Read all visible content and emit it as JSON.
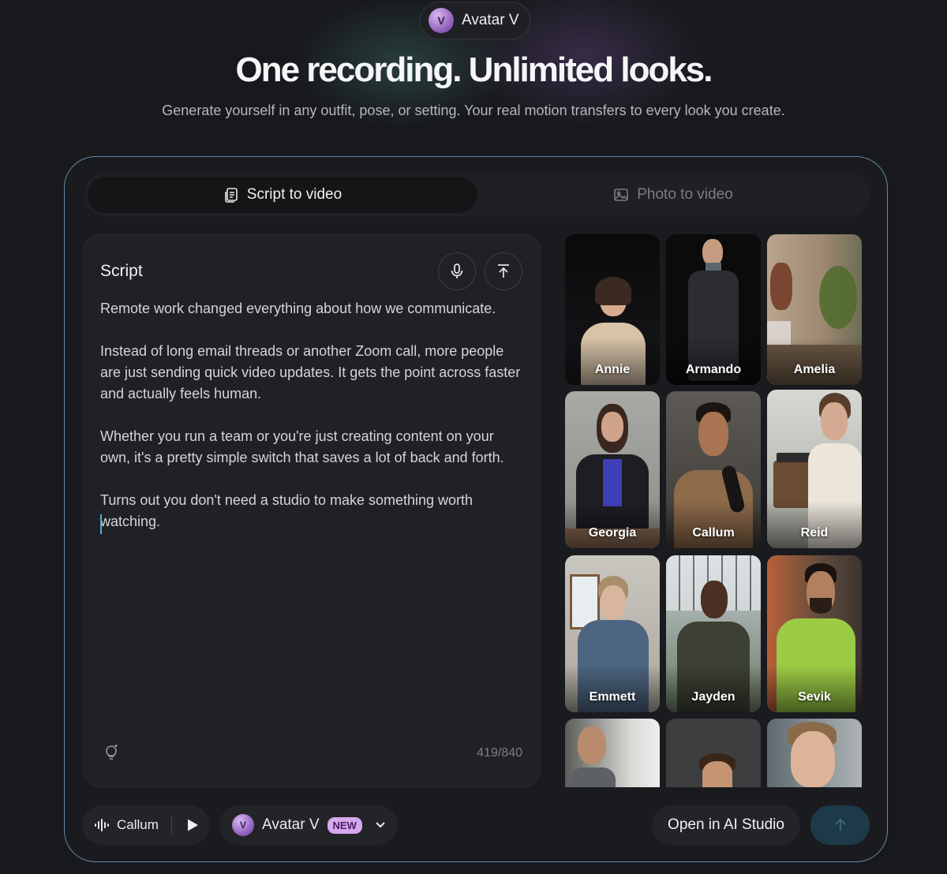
{
  "top_pill": {
    "badge": "V",
    "label": "Avatar V"
  },
  "headline": "One recording. Unlimited looks.",
  "subhead": "Generate yourself in any outfit, pose, or setting. Your real motion transfers to every look you create.",
  "tabs": [
    {
      "label": "Script to video",
      "icon": "script-icon",
      "active": true
    },
    {
      "label": "Photo to video",
      "icon": "image-icon",
      "active": false
    }
  ],
  "script": {
    "title": "Script",
    "paragraphs": [
      "Remote work changed everything about how we communicate.",
      "Instead of long email threads or another Zoom call, more people are just sending quick video updates. It gets the point across faster and actually feels human.",
      "Whether you run a team or you're just creating content on your own, it's a pretty simple switch that saves a lot of back and forth.",
      "Turns out you don't need a studio to make something worth watching."
    ],
    "counter": "419/840",
    "icons": [
      "microphone-icon",
      "upload-icon",
      "lightbulb-icon"
    ]
  },
  "avatars": [
    {
      "name": "Annie"
    },
    {
      "name": "Armando"
    },
    {
      "name": "Amelia"
    },
    {
      "name": "Georgia"
    },
    {
      "name": "Callum"
    },
    {
      "name": "Reid"
    },
    {
      "name": "Emmett"
    },
    {
      "name": "Jayden"
    },
    {
      "name": "Sevik"
    },
    {
      "name": ""
    },
    {
      "name": ""
    },
    {
      "name": ""
    }
  ],
  "bottom": {
    "voice_label": "Callum",
    "model_badge": "V",
    "model_label": "Avatar V",
    "new_badge": "NEW",
    "studio_button": "Open in AI Studio"
  }
}
